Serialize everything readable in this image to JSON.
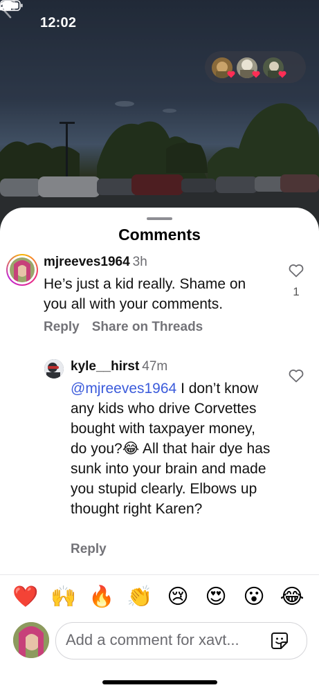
{
  "status_bar": {
    "time": "12:02"
  },
  "sheet": {
    "title": "Comments"
  },
  "comments": [
    {
      "username": "mjreeves1964",
      "time": "3h",
      "text": "He’s just a kid really.  Shame on you all with your comments.",
      "likes": "1",
      "actions": {
        "reply": "Reply",
        "share": "Share on Threads"
      }
    }
  ],
  "reply": {
    "username": "kyle__hirst",
    "time": "47m",
    "mention": "@mjreeves1964",
    "text": " I don’t know any kids who drive Corvettes bought with taxpayer money, do you?😂 All that hair dye has sunk into your brain and made you stupid clearly. Elbows up thought right Karen?",
    "actions": {
      "reply": "Reply"
    }
  },
  "quick_reactions": [
    "❤️",
    "🙌",
    "🔥",
    "👏",
    "😢",
    "😍",
    "😮",
    "😂"
  ],
  "composer": {
    "placeholder": "Add a comment for xavt..."
  },
  "icons": {
    "back": "chevron-left-icon",
    "viewers_more": "chevron-right-icon",
    "like": "heart-outline-icon",
    "sticker": "sticker-icon"
  },
  "colors": {
    "mention": "#3b5bdb",
    "secondary_text": "#737378",
    "story_ring": "#ee2a7b"
  }
}
